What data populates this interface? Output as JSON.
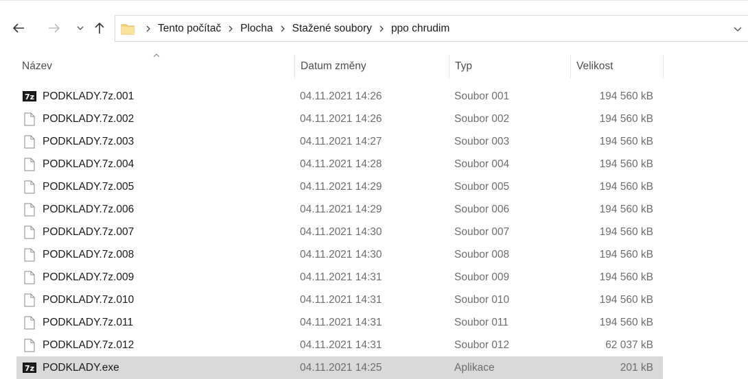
{
  "address": {
    "crumbs": [
      "Tento počítač",
      "Plocha",
      "Stažené soubory",
      "ppo chrudim"
    ]
  },
  "columns": {
    "name": "Název",
    "date": "Datum změny",
    "type": "Typ",
    "size": "Velikost"
  },
  "files": [
    {
      "icon": "7z-icon",
      "name": "PODKLADY.7z.001",
      "date": "04.11.2021 14:26",
      "type": "Soubor 001",
      "size": "194 560 kB"
    },
    {
      "icon": "file-icon",
      "name": "PODKLADY.7z.002",
      "date": "04.11.2021 14:26",
      "type": "Soubor 002",
      "size": "194 560 kB"
    },
    {
      "icon": "file-icon",
      "name": "PODKLADY.7z.003",
      "date": "04.11.2021 14:27",
      "type": "Soubor 003",
      "size": "194 560 kB"
    },
    {
      "icon": "file-icon",
      "name": "PODKLADY.7z.004",
      "date": "04.11.2021 14:28",
      "type": "Soubor 004",
      "size": "194 560 kB"
    },
    {
      "icon": "file-icon",
      "name": "PODKLADY.7z.005",
      "date": "04.11.2021 14:29",
      "type": "Soubor 005",
      "size": "194 560 kB"
    },
    {
      "icon": "file-icon",
      "name": "PODKLADY.7z.006",
      "date": "04.11.2021 14:29",
      "type": "Soubor 006",
      "size": "194 560 kB"
    },
    {
      "icon": "file-icon",
      "name": "PODKLADY.7z.007",
      "date": "04.11.2021 14:30",
      "type": "Soubor 007",
      "size": "194 560 kB"
    },
    {
      "icon": "file-icon",
      "name": "PODKLADY.7z.008",
      "date": "04.11.2021 14:30",
      "type": "Soubor 008",
      "size": "194 560 kB"
    },
    {
      "icon": "file-icon",
      "name": "PODKLADY.7z.009",
      "date": "04.11.2021 14:31",
      "type": "Soubor 009",
      "size": "194 560 kB"
    },
    {
      "icon": "file-icon",
      "name": "PODKLADY.7z.010",
      "date": "04.11.2021 14:31",
      "type": "Soubor 010",
      "size": "194 560 kB"
    },
    {
      "icon": "file-icon",
      "name": "PODKLADY.7z.011",
      "date": "04.11.2021 14:31",
      "type": "Soubor 011",
      "size": "194 560 kB"
    },
    {
      "icon": "file-icon",
      "name": "PODKLADY.7z.012",
      "date": "04.11.2021 14:31",
      "type": "Soubor 012",
      "size": "62 037 kB"
    },
    {
      "icon": "7z-icon",
      "name": "PODKLADY.exe",
      "date": "04.11.2021 14:25",
      "type": "Aplikace",
      "size": "201 kB",
      "selected": true
    }
  ],
  "icon_labels": {
    "seven_zip": "7z"
  },
  "colors": {
    "selected_row": "#d9d9d9",
    "folder": "#f8d775"
  }
}
